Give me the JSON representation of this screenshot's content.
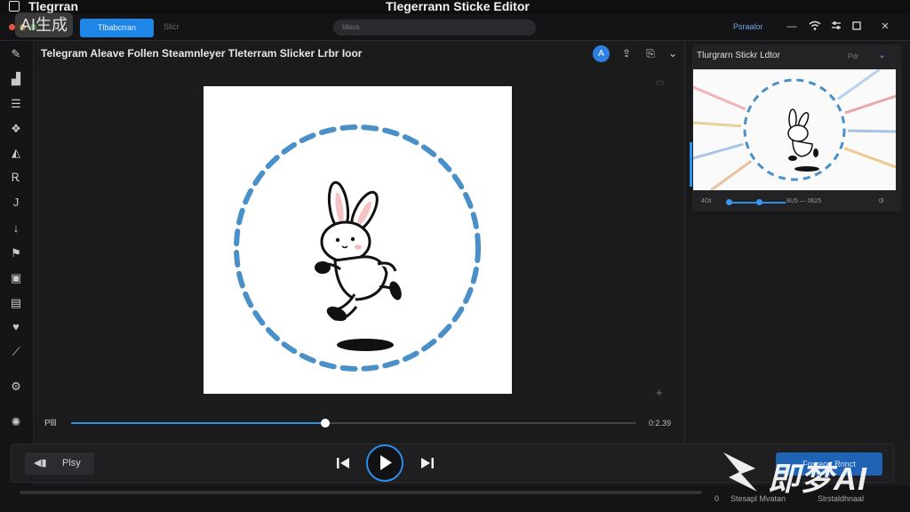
{
  "titlebar": {
    "app_name": "Tlegrran",
    "window_title": "Tlegerrann Sticke Editor"
  },
  "toolbar": {
    "badge": "AI生成",
    "active_tab": "Tlbabcrran",
    "inactive_tab": "Slicr",
    "search_placeholder": "Idaus",
    "right_label": "Psraalor",
    "traffic_colors": [
      "#e8543f",
      "#f2b431",
      "#3fc04f"
    ]
  },
  "main": {
    "title": "Telegram Aleave Follen Steamnleyer Tleterram Slicker Lrbr Ioor",
    "scrubber": {
      "label": "Plll",
      "progress": 0.45,
      "time": "0:2.39"
    }
  },
  "preview": {
    "title": "Tlurgrarn Stickr Ldtor",
    "mini_label": "Pdr",
    "scrub_start": "4Ot",
    "scrub_mid": "8U5 — 0625",
    "scrub_end": "0l"
  },
  "transport": {
    "play_label": "Plsy",
    "export_label": "Fnsreort Rnnct"
  },
  "status": {
    "progress": 0.0,
    "items": [
      "0",
      "Stesapl Mvatan",
      "Slrstaldhnaal"
    ]
  },
  "watermark": {
    "text": "即梦AI"
  },
  "colors": {
    "accent": "#2d8fe8",
    "bg": "#1c1c1c",
    "dash_blue": "#4a90c8"
  }
}
